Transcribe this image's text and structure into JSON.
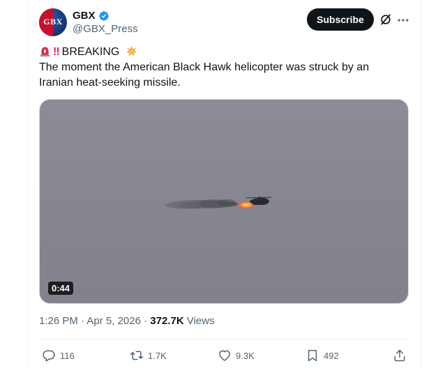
{
  "author": {
    "display_name": "GBX",
    "handle": "@GBX_Press",
    "avatar_text": "GBX"
  },
  "header": {
    "subscribe_label": "Subscribe"
  },
  "tweet": {
    "headline_marks": "‼",
    "headline": "BREAKING",
    "body_line1": "The moment the American Black Hawk helicopter was struck by an",
    "body_line2": "Iranian heat-seeking missile."
  },
  "media": {
    "duration": "0:44"
  },
  "meta": {
    "time": "1:26 PM",
    "separator": "·",
    "date": "Apr 5, 2026",
    "separator2": "·",
    "views_count": "372.7K",
    "views_label": "Views"
  },
  "actions": {
    "replies": "116",
    "reposts": "1.7K",
    "likes": "9.3K",
    "bookmarks": "492"
  },
  "icons": [
    "verified-badge-icon",
    "grok-icon",
    "more-icon",
    "rotating-light-icon",
    "collision-icon",
    "reply-icon",
    "repost-icon",
    "like-icon",
    "bookmark-icon",
    "share-icon"
  ],
  "colors": {
    "verified_blue": "#1d9bf0",
    "text_primary": "#0f1419",
    "text_secondary": "#536471",
    "button_dark": "#0f1419"
  }
}
